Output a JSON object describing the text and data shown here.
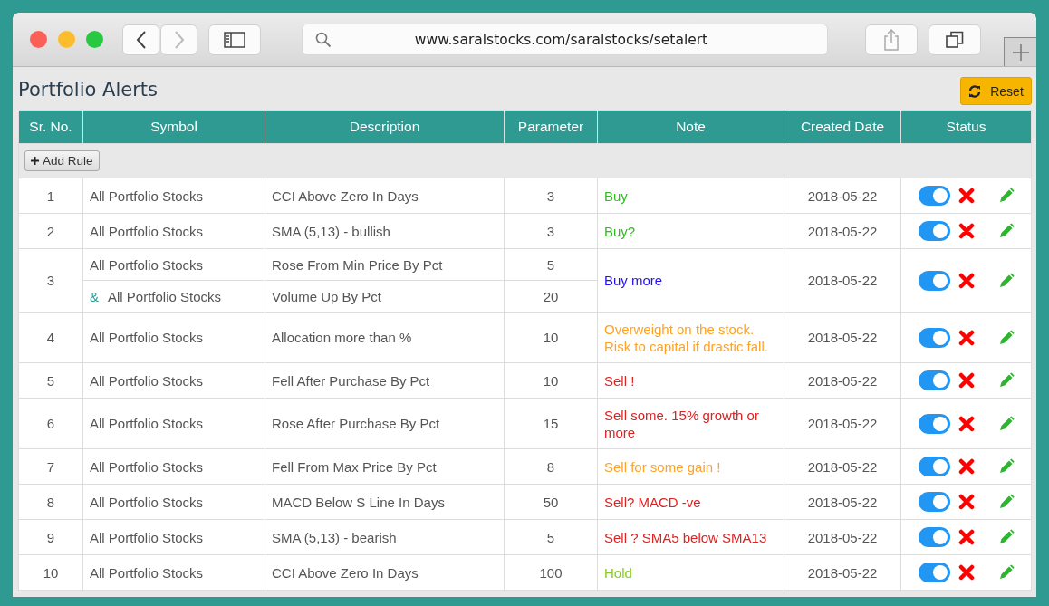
{
  "browser": {
    "url": "www.saralstocks.com/saralstocks/setalert"
  },
  "page": {
    "title": "Portfolio Alerts",
    "reset_button": "Reset",
    "add_rule_button": "Add Rule"
  },
  "table": {
    "columns": [
      "Sr. No.",
      "Symbol",
      "Description",
      "Parameter",
      "Note",
      "Created Date",
      "Status"
    ],
    "rows": [
      {
        "sr": "1",
        "rules": [
          {
            "symbol": "All Portfolio Stocks",
            "description": "CCI Above Zero In Days",
            "parameter": "3"
          }
        ],
        "note": "Buy",
        "color": "#33bb22",
        "date": "2018-05-22",
        "on": true
      },
      {
        "sr": "2",
        "rules": [
          {
            "symbol": "All Portfolio Stocks",
            "description": "SMA (5,13) - bullish",
            "parameter": "3"
          }
        ],
        "note": "Buy?",
        "color": "#33bb22",
        "date": "2018-05-22",
        "on": true
      },
      {
        "sr": "3",
        "rules": [
          {
            "symbol": "All Portfolio Stocks",
            "description": "Rose From Min Price By Pct",
            "parameter": "5"
          },
          {
            "joiner": "&",
            "symbol": "All Portfolio Stocks",
            "description": "Volume Up By Pct",
            "parameter": "20"
          }
        ],
        "note": "Buy more",
        "color": "#2211ee",
        "date": "2018-05-22",
        "on": true
      },
      {
        "sr": "4",
        "rules": [
          {
            "symbol": "All Portfolio Stocks",
            "description": "Allocation more than %",
            "parameter": "10"
          }
        ],
        "note": "Overweight on the stock. Risk to capital if drastic fall.",
        "color": "#ffa224",
        "date": "2018-05-22",
        "on": true
      },
      {
        "sr": "5",
        "rules": [
          {
            "symbol": "All Portfolio Stocks",
            "description": "Fell After Purchase By Pct",
            "parameter": "10"
          }
        ],
        "note": "Sell !",
        "color": "#dd2222",
        "date": "2018-05-22",
        "on": true
      },
      {
        "sr": "6",
        "rules": [
          {
            "symbol": "All Portfolio Stocks",
            "description": "Rose After Purchase By Pct",
            "parameter": "15"
          }
        ],
        "note": "Sell some. 15% growth or more",
        "color": "#dd2222",
        "date": "2018-05-22",
        "on": true
      },
      {
        "sr": "7",
        "rules": [
          {
            "symbol": "All Portfolio Stocks",
            "description": "Fell From Max Price By Pct",
            "parameter": "8"
          }
        ],
        "note": "Sell for some gain !",
        "color": "#ffa224",
        "date": "2018-05-22",
        "on": true
      },
      {
        "sr": "8",
        "rules": [
          {
            "symbol": "All Portfolio Stocks",
            "description": "MACD Below S Line In Days",
            "parameter": "50"
          }
        ],
        "note": "Sell? MACD -ve",
        "color": "#dd2222",
        "date": "2018-05-22",
        "on": true
      },
      {
        "sr": "9",
        "rules": [
          {
            "symbol": "All Portfolio Stocks",
            "description": "SMA (5,13) - bearish",
            "parameter": "5"
          }
        ],
        "note": "Sell ? SMA5 below SMA13",
        "color": "#dd2222",
        "date": "2018-05-22",
        "on": true
      },
      {
        "sr": "10",
        "rules": [
          {
            "symbol": "All Portfolio Stocks",
            "description": "CCI Above Zero In Days",
            "parameter": "100"
          }
        ],
        "note": "Hold",
        "color": "#88cc22",
        "date": "2018-05-22",
        "on": true
      }
    ]
  }
}
